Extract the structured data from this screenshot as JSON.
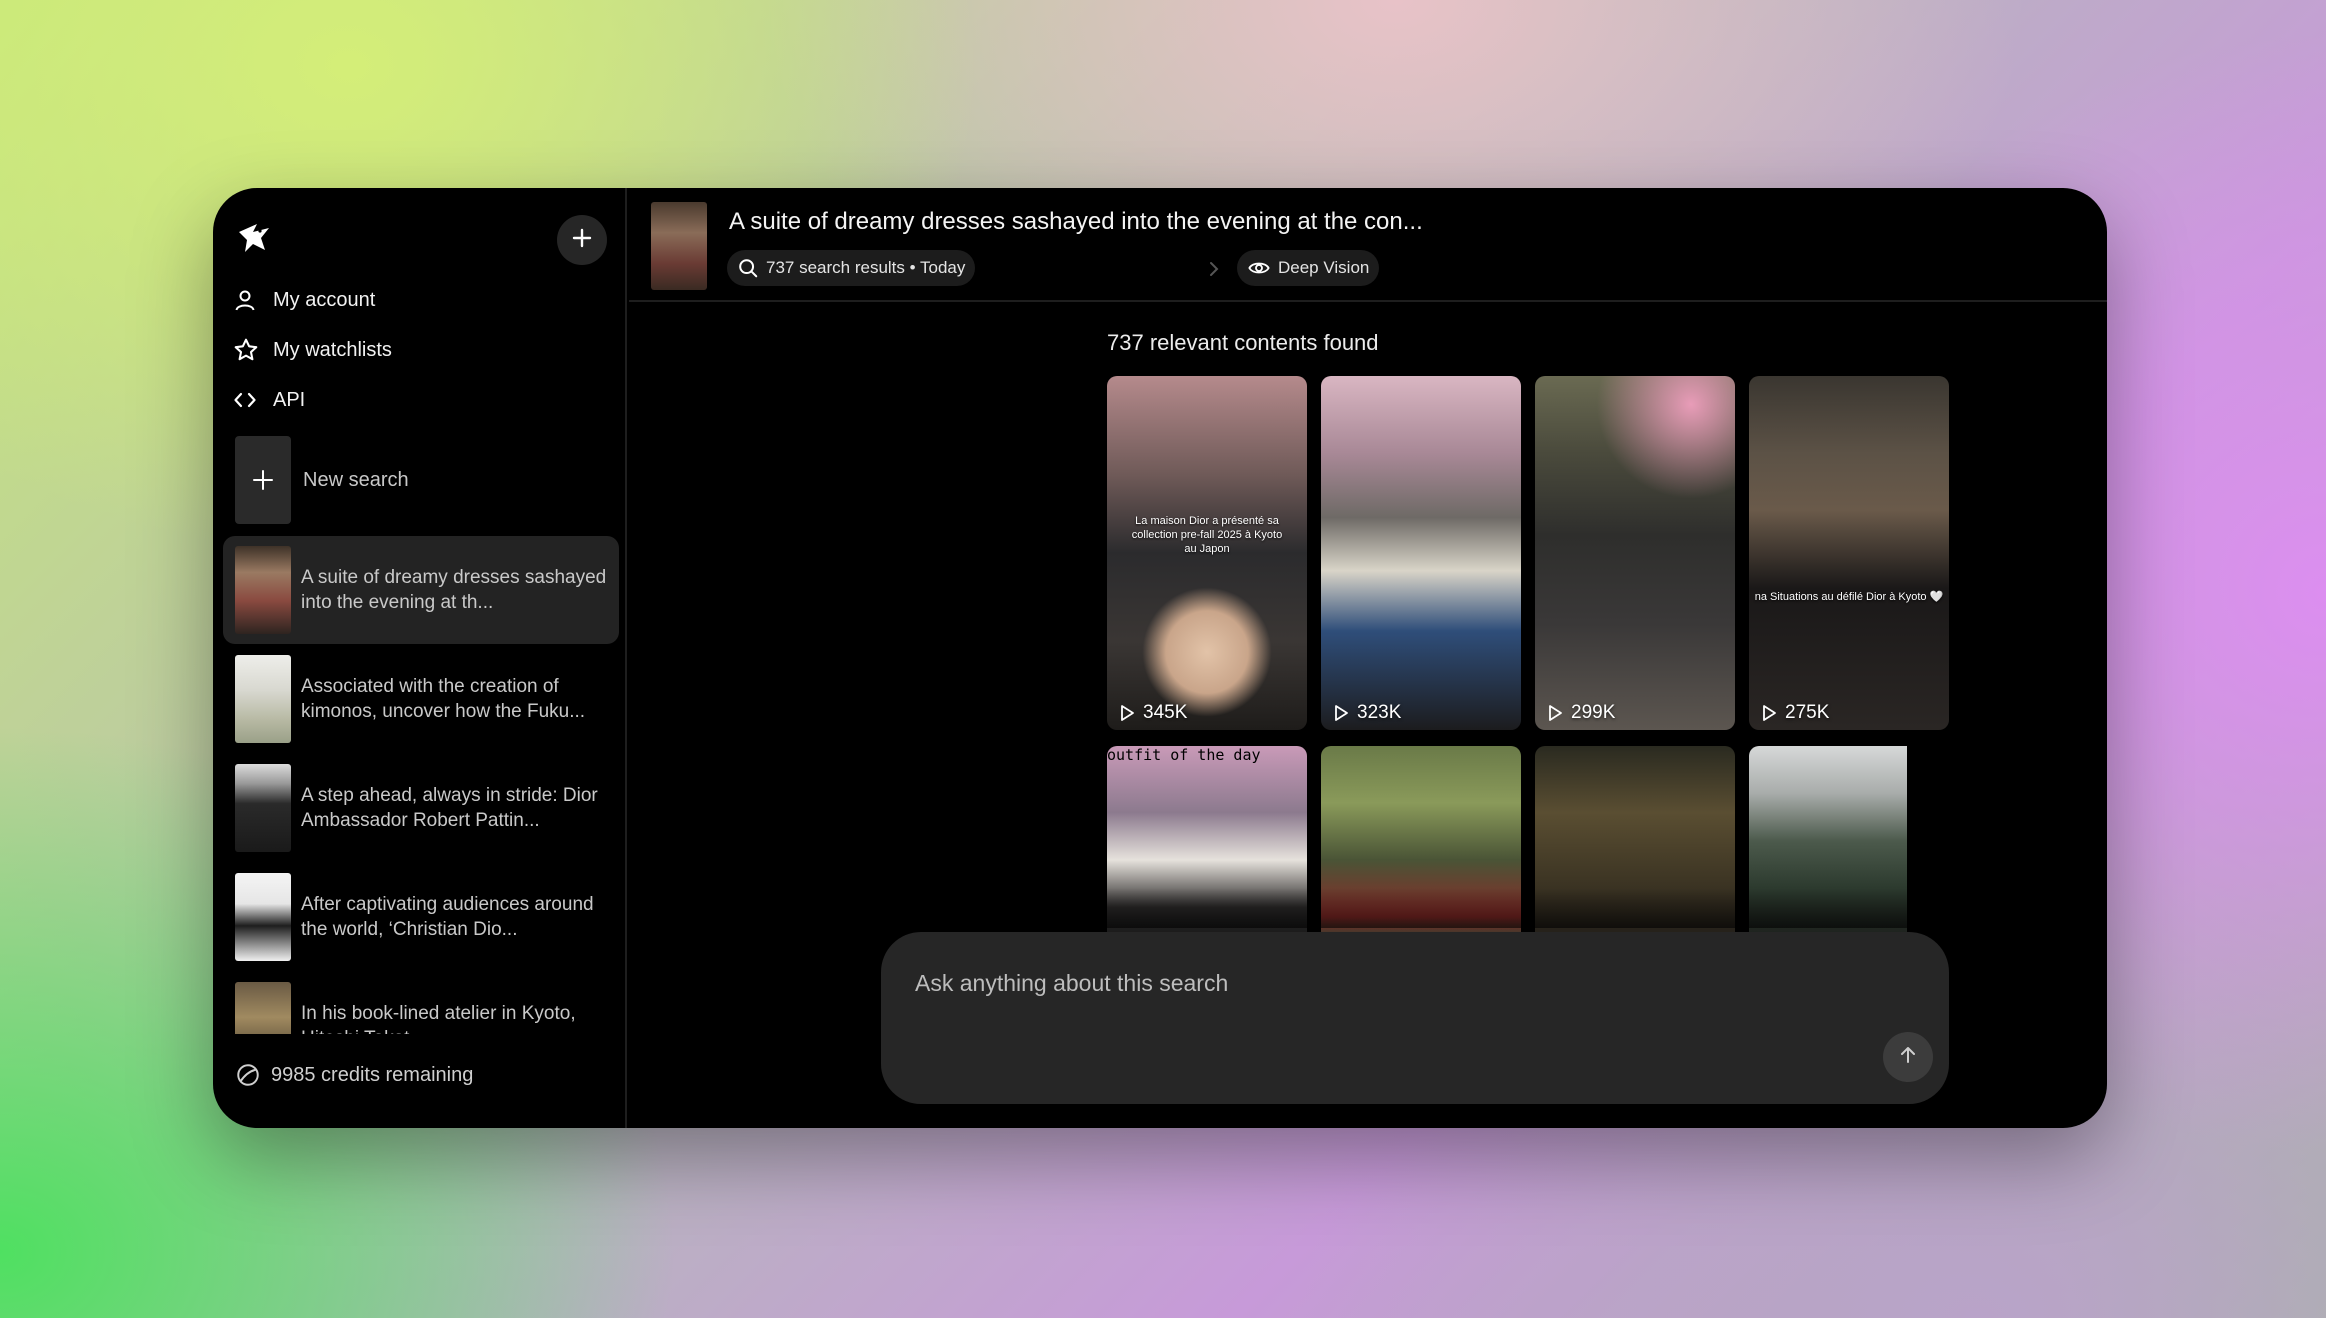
{
  "sidebar": {
    "logo_icon": "dove-logo-icon",
    "new_icon": "plus-icon",
    "nav": [
      {
        "label": "My account",
        "icon": "user-icon"
      },
      {
        "label": "My watchlists",
        "icon": "star-icon"
      },
      {
        "label": "API",
        "icon": "code-icon"
      }
    ],
    "new_search_label": "New search",
    "history": [
      {
        "text": "A suite of dreamy dresses sashayed into the evening at th...",
        "active": true
      },
      {
        "text": "Associated with the creation of kimonos, uncover how the Fuku..."
      },
      {
        "text": "A step ahead, always in stride: Dior Ambassador Robert Pattin..."
      },
      {
        "text": "After captivating audiences around the world, ‘Christian Dio..."
      },
      {
        "text": "In his book-lined atelier in Kyoto, Hitoshi Takat..."
      }
    ],
    "credits_label": "9985 credits remaining"
  },
  "header": {
    "title": "A suite of dreamy dresses sashayed into the evening at the con...",
    "results_pill": "737 search results • Today",
    "vision_pill": "Deep Vision"
  },
  "main": {
    "found_label": "737 relevant contents found",
    "cards": [
      {
        "views": "345K",
        "caption": "La maison Dior a présenté sa collection pre-fall 2025 à Kyoto au Japon"
      },
      {
        "views": "323K",
        "caption": ""
      },
      {
        "views": "299K",
        "caption": ""
      },
      {
        "views": "275K",
        "caption": "na Situations au défilé Dior à Kyoto 🤍"
      }
    ],
    "row2_caption": "outfit of the day"
  },
  "ask": {
    "placeholder": "Ask anything about this search",
    "send_icon": "arrow-up-icon"
  }
}
